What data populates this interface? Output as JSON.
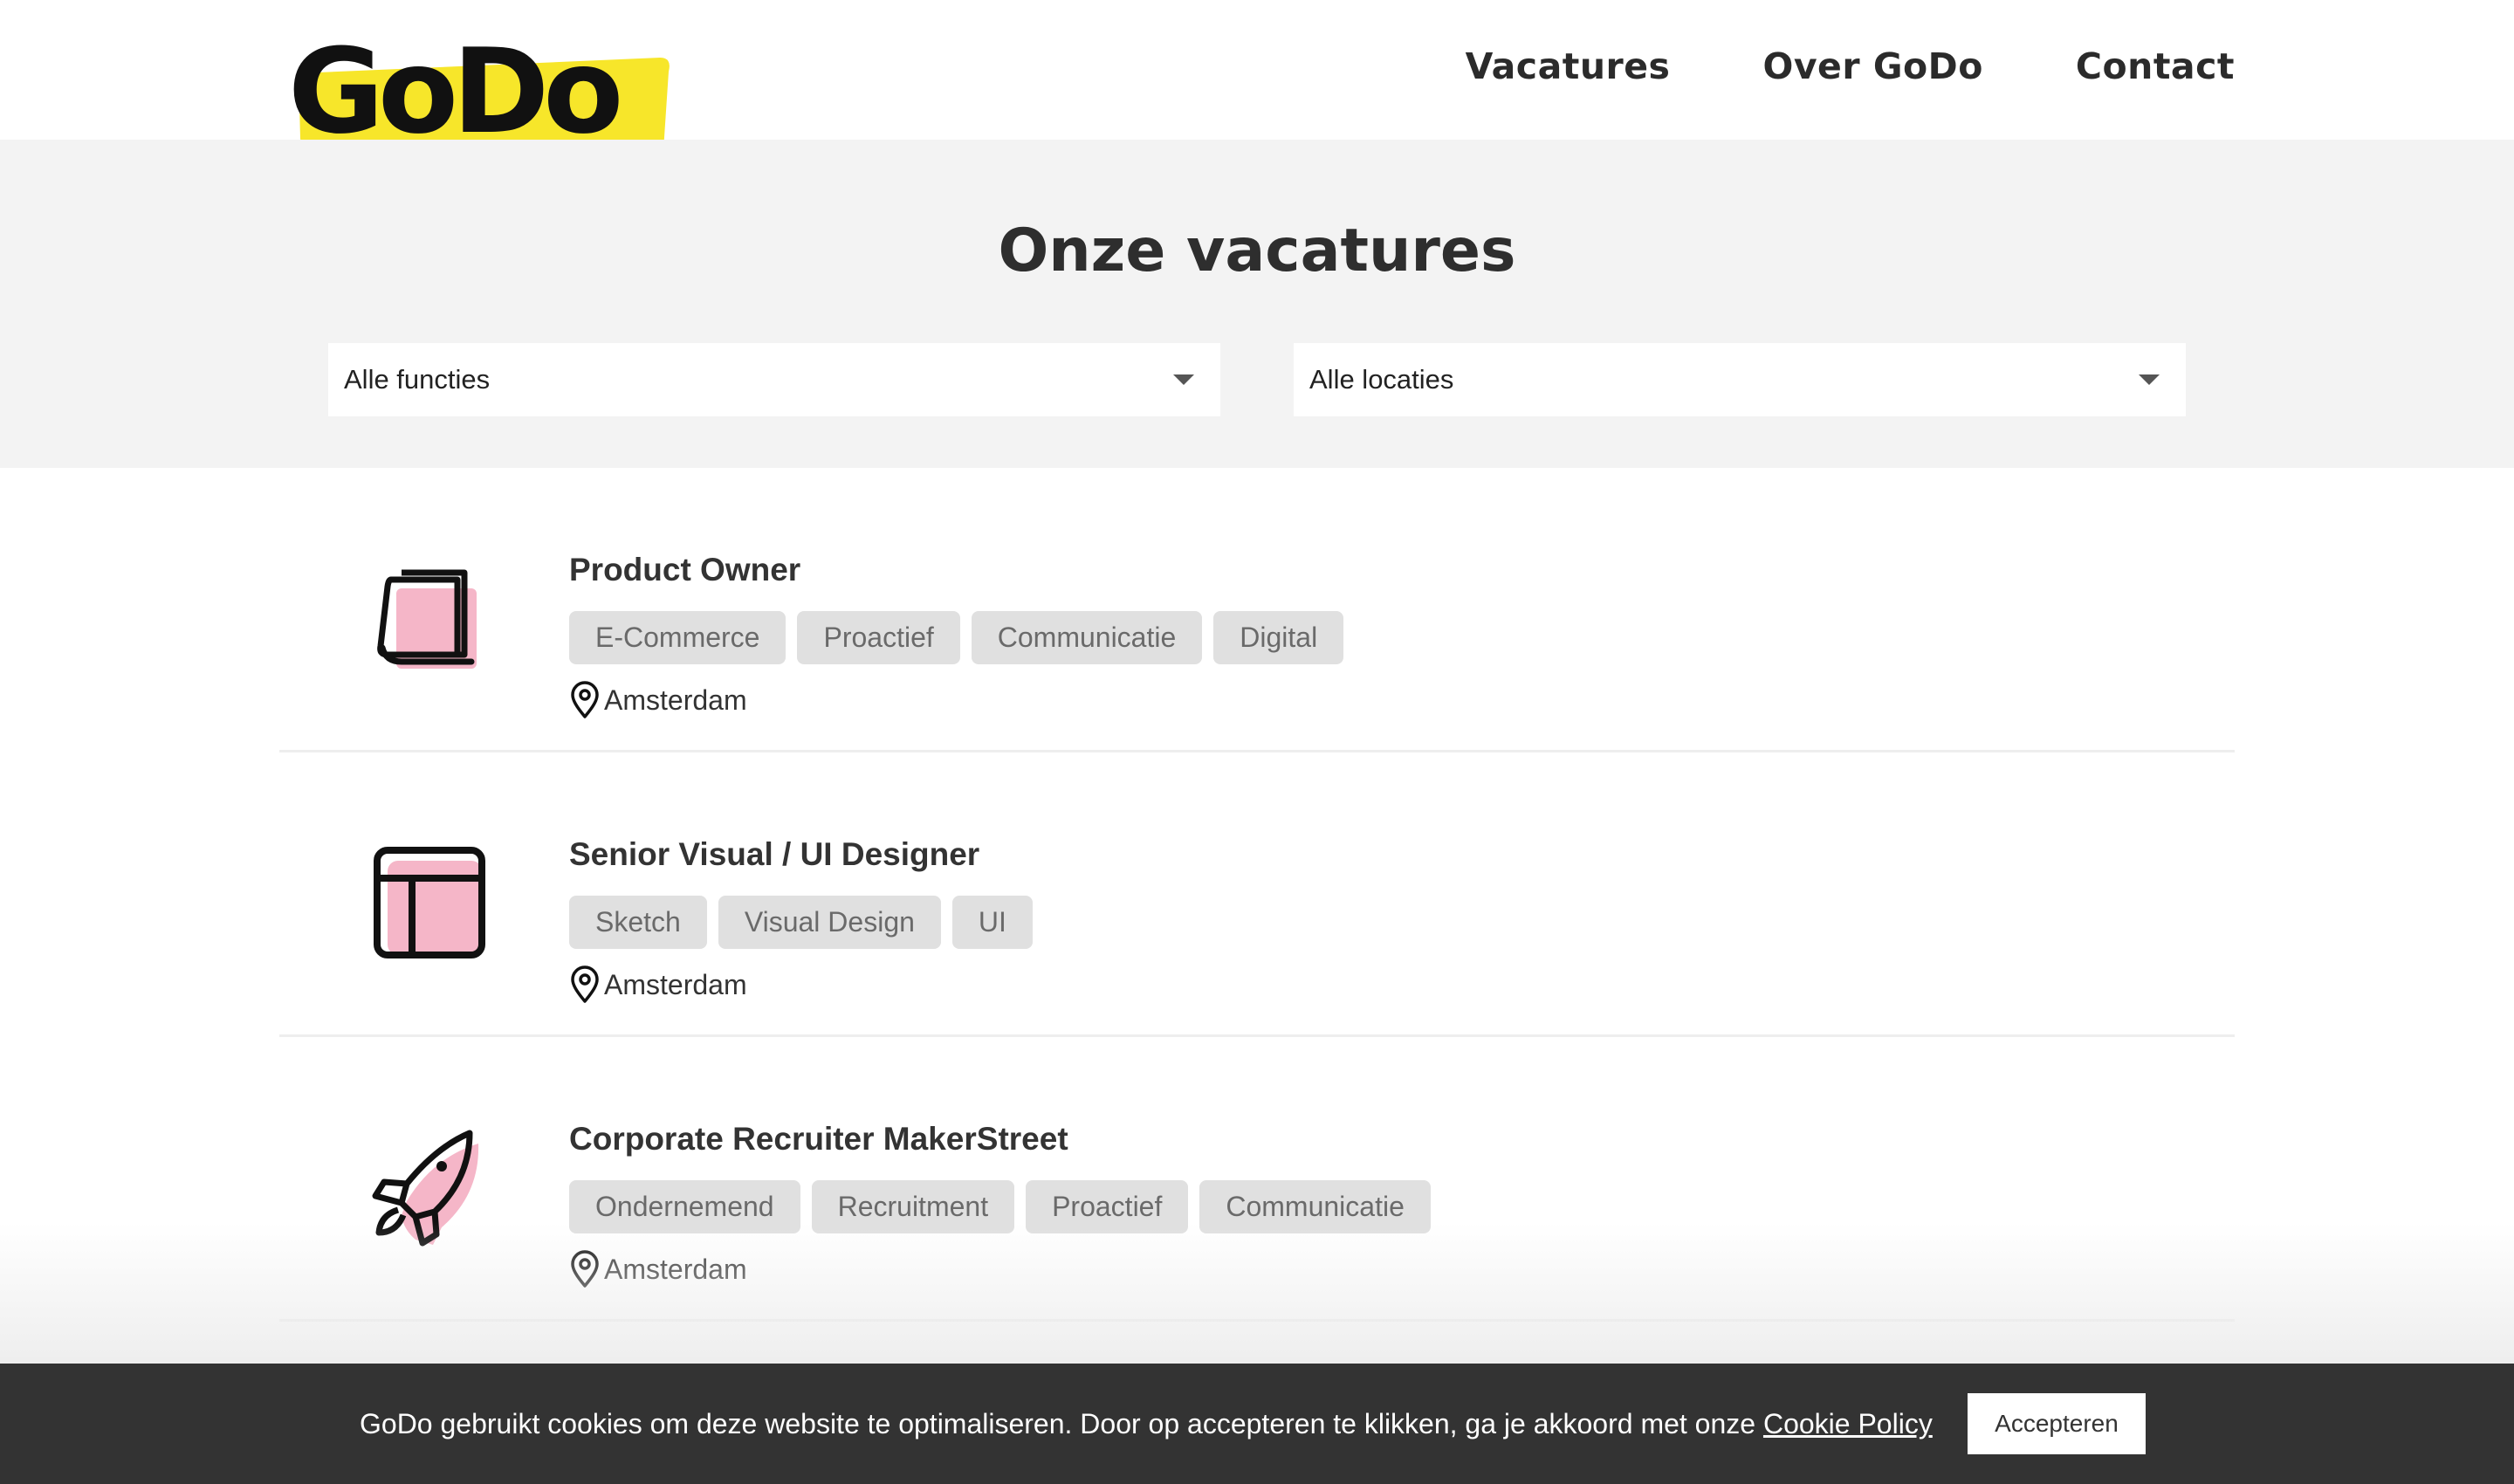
{
  "header": {
    "logo_text": "GoDo",
    "nav": [
      "Vacatures",
      "Over GoDo",
      "Contact"
    ]
  },
  "hero": {
    "title": "Onze vacatures",
    "filter_functions": "Alle functies",
    "filter_locations": "Alle locaties"
  },
  "jobs": [
    {
      "title": "Product Owner",
      "icon": "stacked-pages-icon",
      "tags": [
        "E-Commerce",
        "Proactief",
        "Communicatie",
        "Digital"
      ],
      "location": "Amsterdam"
    },
    {
      "title": "Senior Visual / UI Designer",
      "icon": "layout-window-icon",
      "tags": [
        "Sketch",
        "Visual Design",
        "UI"
      ],
      "location": "Amsterdam"
    },
    {
      "title": "Corporate Recruiter MakerStreet",
      "icon": "rocket-icon",
      "tags": [
        "Ondernemend",
        "Recruitment",
        "Proactief",
        "Communicatie"
      ],
      "location": "Amsterdam"
    }
  ],
  "cookie": {
    "text": "GoDo gebruikt cookies om deze website te optimaliseren. Door op accepteren te klikken, ga je akkoord met onze ",
    "link": "Cookie Policy",
    "button": "Accepteren"
  },
  "colors": {
    "brand_yellow": "#f7e62a",
    "icon_pink": "#f5b6c8",
    "hero_bg": "#f3f3f3",
    "tag_bg": "#e0e0e0",
    "cookie_bg": "#333333"
  }
}
